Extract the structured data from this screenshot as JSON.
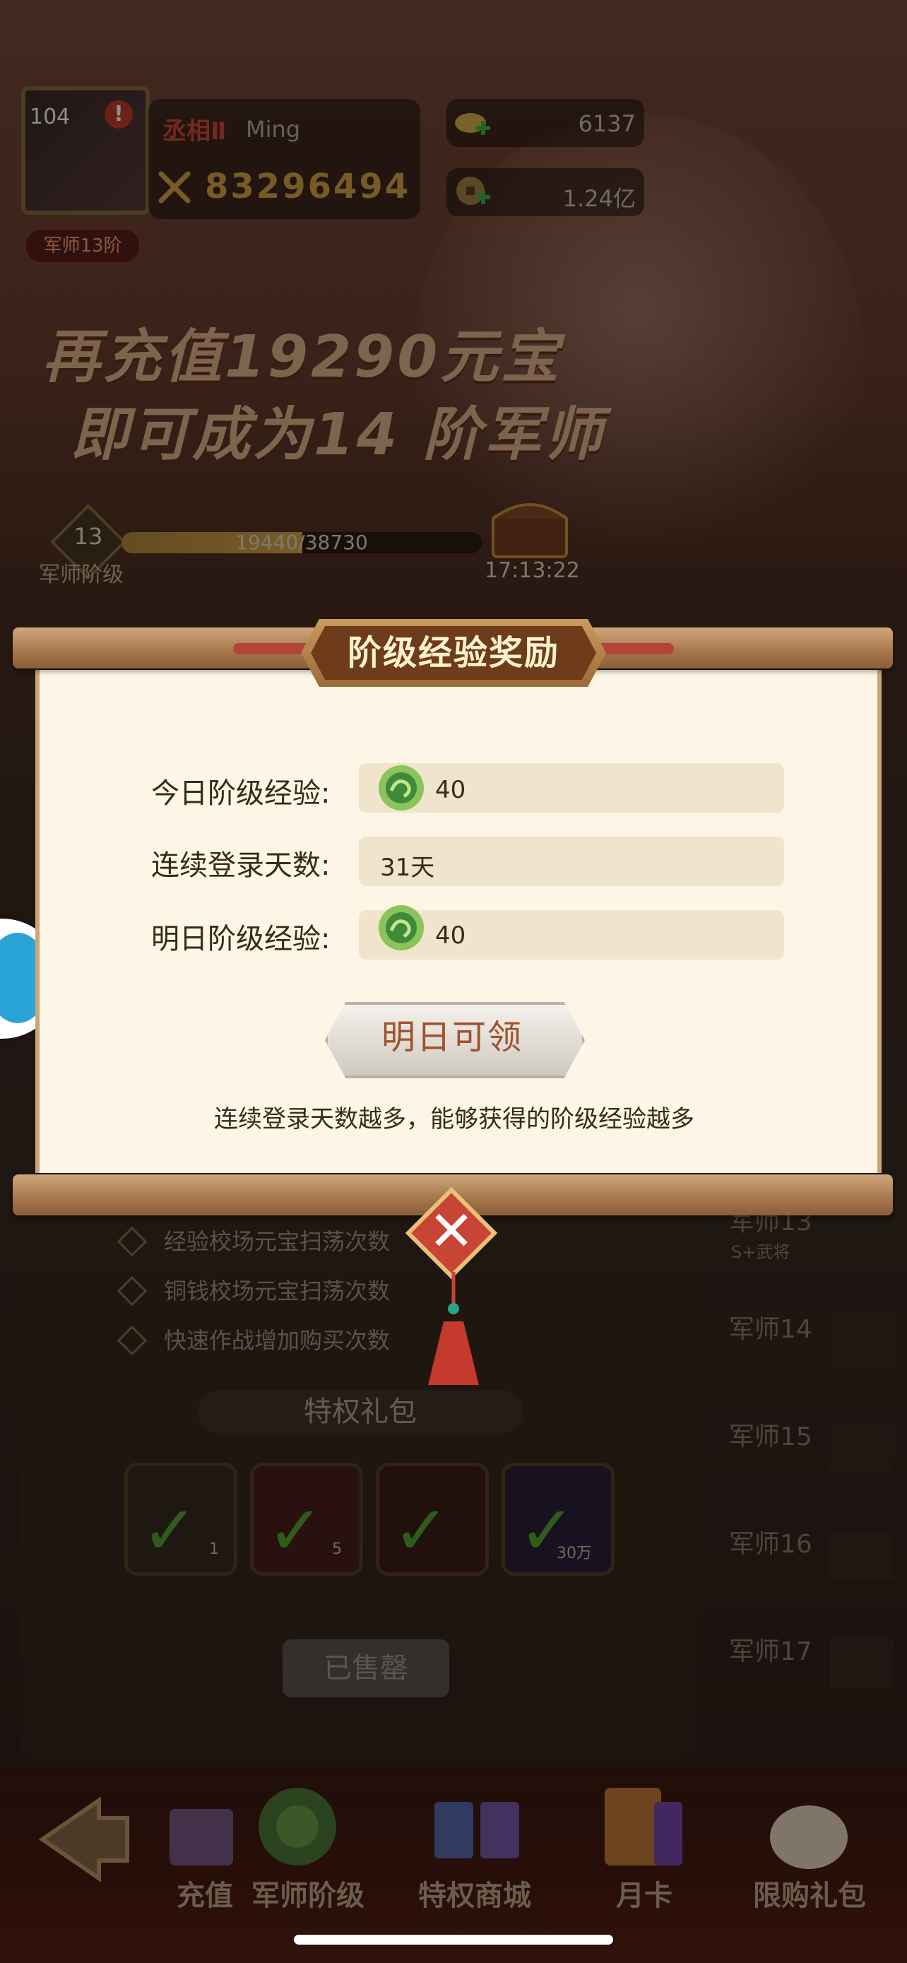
{
  "header": {
    "avatar_level": "104",
    "alert": "!",
    "rank_badge": "军师13阶",
    "title_tag": "丞相Ⅱ",
    "player_name": "Ming",
    "combat_power": "83296494",
    "gold": "6137",
    "coins": "1.24亿"
  },
  "promo": {
    "line1": "再充值19290元宝",
    "line2": "即可成为14 阶军师"
  },
  "tier": {
    "level": "13",
    "label": "军师阶级",
    "progress_text": "19440/38730",
    "progress_fraction": 0.502,
    "chest_timer": "17:13:22"
  },
  "background_list": {
    "bullets": [
      "经验校场元宝扫荡次数",
      "铜钱校场元宝扫荡次数",
      "快速作战增加购买次数"
    ],
    "perk_title": "特权礼包",
    "gifts": [
      {
        "count": "1"
      },
      {
        "count": "5"
      },
      {
        "count": ""
      },
      {
        "count": "30万"
      }
    ],
    "soldout": "已售罄",
    "side_items": [
      "军师13",
      "军师14",
      "军师15",
      "军师16",
      "军师17"
    ],
    "side_sub": "S+武将"
  },
  "modal": {
    "title": "阶级经验奖励",
    "rows": [
      {
        "label": "今日阶级经验:",
        "value": "40"
      },
      {
        "label": "连续登录天数:",
        "value": "31天"
      },
      {
        "label": "明日阶级经验:",
        "value": "40"
      }
    ],
    "claim_button": "明日可领",
    "hint": "连续登录天数越多，能够获得的阶级经验越多",
    "close": "✕"
  },
  "bottom_tabs": [
    {
      "label": "充值",
      "icon": "gift-icon"
    },
    {
      "label": "军师阶级",
      "icon": "dragon-icon"
    },
    {
      "label": "特权商城",
      "icon": "shop-icon"
    },
    {
      "label": "月卡",
      "icon": "card-icon"
    },
    {
      "label": "限购礼包",
      "icon": "bag-icon"
    }
  ],
  "colors": {
    "accent": "#d9a645",
    "modal_bg": "#fdf6e6",
    "claim_text": "#a0522d"
  }
}
